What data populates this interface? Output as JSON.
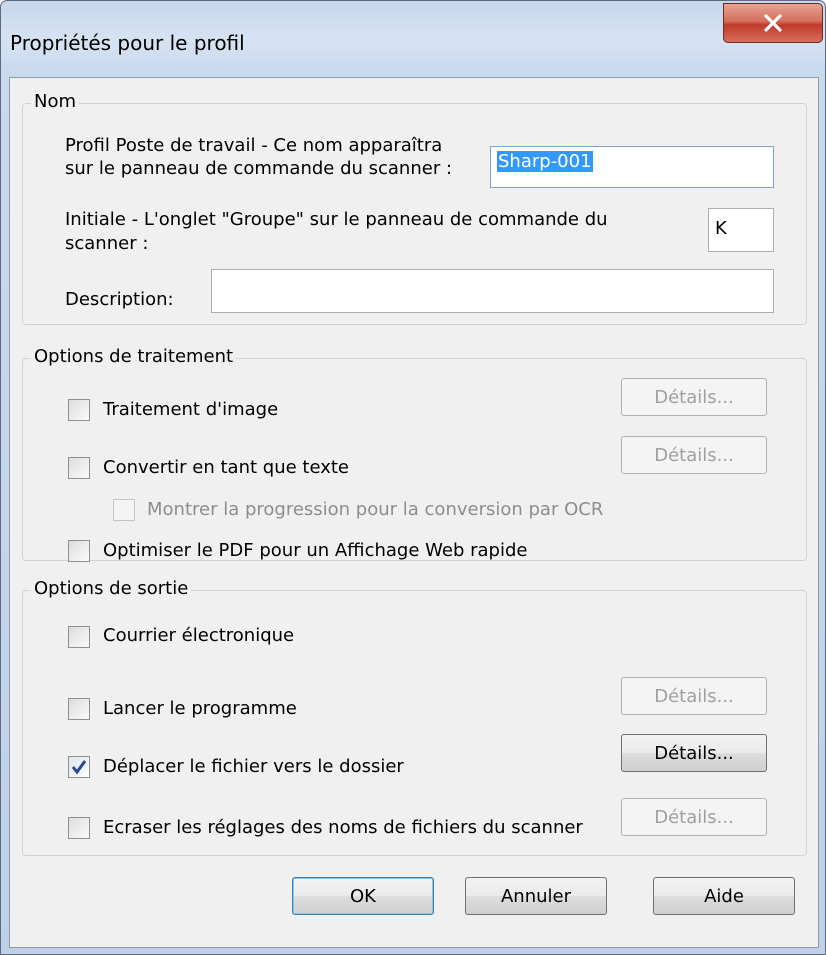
{
  "window": {
    "title": "Propriétés pour le profil",
    "close_symbol": "X"
  },
  "nom_group": {
    "legend": "Nom",
    "profil_label_line1": "Profil Poste de travail - Ce nom apparaîtra",
    "profil_label_line2": "sur le panneau de commande du scanner :",
    "profil_value": "Sharp-001",
    "initiale_label_line1": "Initiale - L'onglet \"Groupe\" sur le panneau de commande du",
    "initiale_label_line2": "scanner :",
    "initiale_value": "K",
    "description_label": "Description:",
    "description_value": ""
  },
  "traitement_group": {
    "legend": "Options de traitement",
    "items": [
      {
        "label": "Traitement d'image",
        "checked": false,
        "enabled": true
      },
      {
        "label": "Convertir en tant que texte",
        "checked": false,
        "enabled": true
      },
      {
        "label": "Montrer la progression pour la conversion par OCR",
        "checked": false,
        "enabled": false
      },
      {
        "label": "Optimiser le PDF pour un Affichage Web rapide",
        "checked": false,
        "enabled": true
      }
    ],
    "details_label": "Détails..."
  },
  "sortie_group": {
    "legend": "Options de sortie",
    "items": [
      {
        "label": "Courrier électronique",
        "checked": false,
        "enabled": true
      },
      {
        "label": "Lancer le programme",
        "checked": false,
        "enabled": true
      },
      {
        "label": "Déplacer le fichier vers le dossier",
        "checked": true,
        "enabled": true
      },
      {
        "label": "Ecraser les réglages des noms de fichiers du scanner",
        "checked": false,
        "enabled": true
      }
    ],
    "details_label": "Détails..."
  },
  "buttons": {
    "ok": "OK",
    "cancel": "Annuler",
    "help": "Aide"
  },
  "icons": [
    "close-icon",
    "checkmark-icon"
  ]
}
